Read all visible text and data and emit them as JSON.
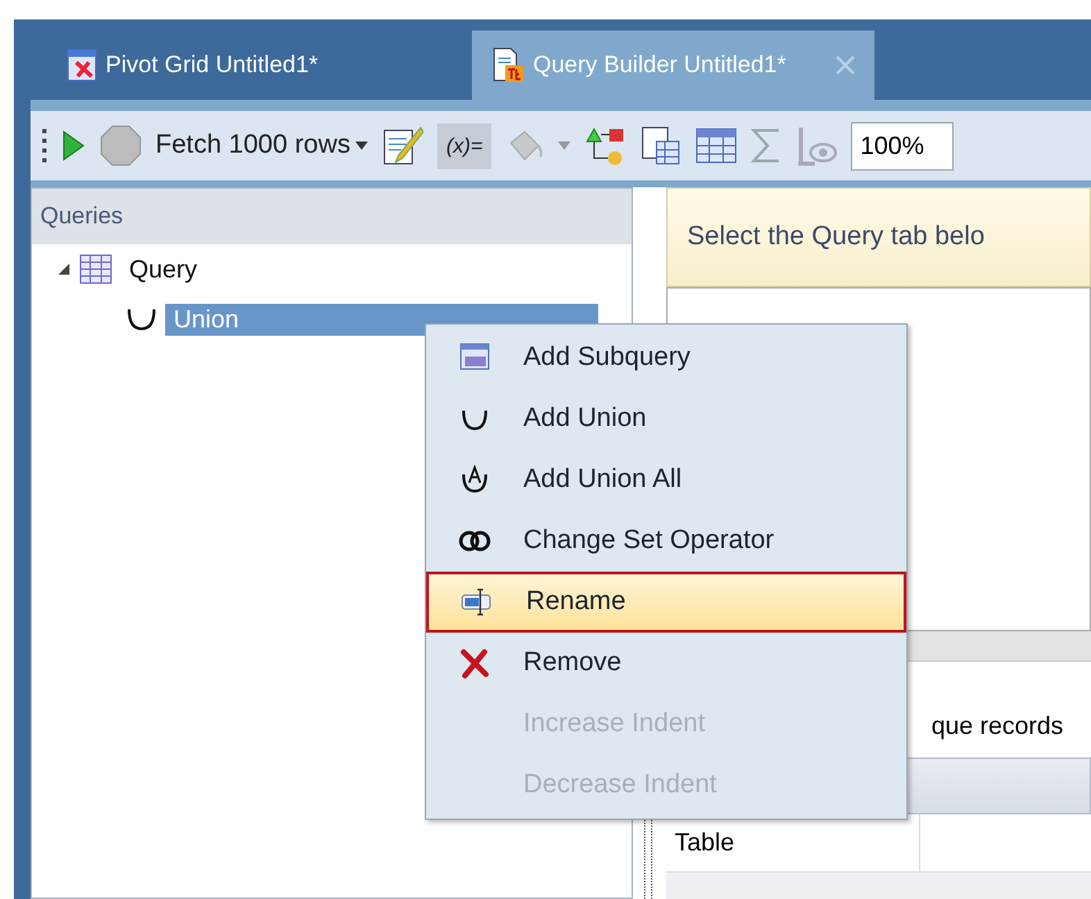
{
  "tabs": [
    {
      "label": "Pivot Grid Untitled1*",
      "selected": false
    },
    {
      "label": "Query Builder Untitled1*",
      "selected": true
    }
  ],
  "toolbar": {
    "fetch_label": "Fetch 1000 rows",
    "variables_label": "(x)=",
    "variables_pressed": true,
    "zoom_value": "100%"
  },
  "queries_panel": {
    "title": "Queries",
    "tree": [
      {
        "label": "Query",
        "expanded": true,
        "selected": false,
        "children": [
          {
            "label": "Union",
            "selected": true
          }
        ]
      }
    ]
  },
  "hint": "Select the Query tab belo",
  "options_fragment": "que records",
  "grid": {
    "rows": [
      {
        "cell": "Table"
      }
    ]
  },
  "context_menu": [
    {
      "label": "Add Subquery",
      "disabled": false,
      "selected": false
    },
    {
      "label": "Add Union",
      "disabled": false,
      "selected": false
    },
    {
      "label": "Add Union All",
      "disabled": false,
      "selected": false
    },
    {
      "label": "Change Set Operator",
      "disabled": false,
      "selected": false
    },
    {
      "label": "Rename",
      "disabled": false,
      "selected": true
    },
    {
      "label": "Remove",
      "disabled": false,
      "selected": false
    },
    {
      "label": "Increase Indent",
      "disabled": true,
      "selected": false
    },
    {
      "label": "Decrease Indent",
      "disabled": true,
      "selected": false
    }
  ]
}
